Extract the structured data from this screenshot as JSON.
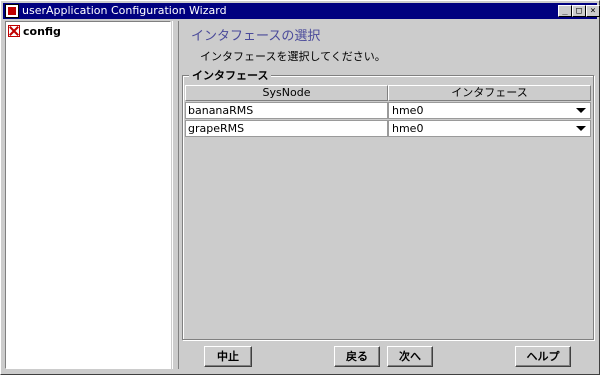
{
  "window": {
    "title": "userApplication Configuration Wizard",
    "controls": {
      "minimize": "_",
      "maximize": "□",
      "close": "×"
    }
  },
  "tree": {
    "items": [
      {
        "label": "config",
        "icon": "config-icon"
      }
    ]
  },
  "page": {
    "title": "インタフェースの選択",
    "instruction": "インタフェースを選択してください。"
  },
  "group": {
    "label": "インタフェース"
  },
  "table": {
    "headers": [
      "SysNode",
      "インタフェース"
    ],
    "rows": [
      {
        "sysnode": "bananaRMS",
        "interface": "hme0"
      },
      {
        "sysnode": "grapeRMS",
        "interface": "hme0"
      }
    ]
  },
  "buttons": {
    "cancel": "中止",
    "back": "戻る",
    "next": "次へ",
    "help": "ヘルプ"
  },
  "colors": {
    "titlebar": "#000080",
    "page_title": "#4a4a9a",
    "background": "#cccccc"
  }
}
